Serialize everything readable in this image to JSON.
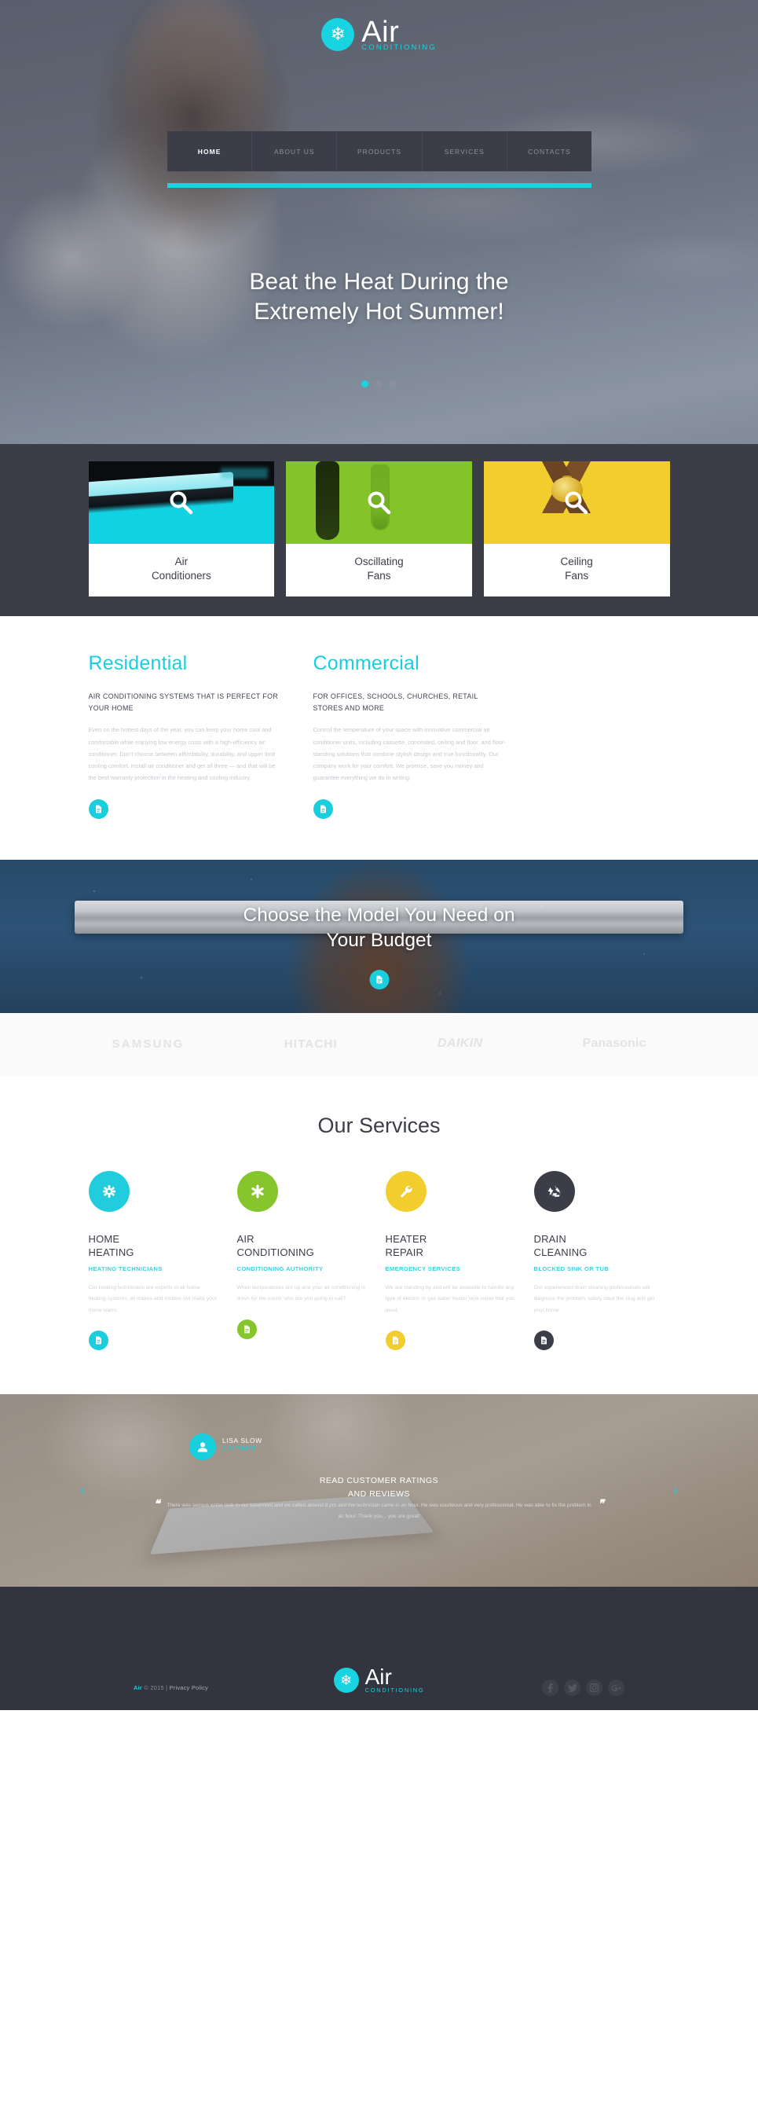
{
  "brand": {
    "name": "Air",
    "tagline": "CONDITIONING",
    "snowflake": "❄",
    "accent": "#17d4e0",
    "dark": "#3b3d49"
  },
  "nav": {
    "items": [
      {
        "label": "HOME",
        "active": true
      },
      {
        "label": "ABOUT US",
        "active": false
      },
      {
        "label": "PRODUCTS",
        "active": false
      },
      {
        "label": "SERVICES",
        "active": false
      },
      {
        "label": "CONTACTS",
        "active": false
      }
    ]
  },
  "hero": {
    "title_line1": "Beat the Heat During the",
    "title_line2": "Extremely Hot Summer!",
    "slides": 3,
    "active_slide": 1
  },
  "products": {
    "cards": [
      {
        "label_line1": "Air",
        "label_line2": "Conditioners",
        "color": "#10d2e2",
        "icon": "search-icon"
      },
      {
        "label_line1": "Oscillating",
        "label_line2": "Fans",
        "color": "#83c429",
        "icon": "search-icon"
      },
      {
        "label_line1": "Ceiling",
        "label_line2": "Fans",
        "color": "#f2cd2e",
        "icon": "search-icon"
      }
    ]
  },
  "rescom": {
    "columns": [
      {
        "heading": "Residential",
        "subheading": "AIR CONDITIONING SYSTEMS THAT IS PERFECT FOR YOUR HOME",
        "body": "Even on the hottest days of the year, you can keep your home cool and comfortable while enjoying low energy costs with a high-efficiency air conditioner. Don't choose between affordability, durability, and upper limit cooling comfort. Install air conditioner and get all three — and that will be the best warranty protection in the heating and cooling industry.",
        "button_color": "#19cfdd"
      },
      {
        "heading": "Commercial",
        "subheading": "FOR OFFICES, SCHOOLS, CHURCHES, RETAIL STORES AND MORE",
        "body": "Control the temperature of your space with innovative commercial air conditioner units, including cassette, concealed, ceiling and floor, and floor-standing solutions that combine stylish design and true functionality. Our company work for your comfort. We promise, save you money and guarantee everything we do in writing.",
        "button_color": "#19cfdd"
      }
    ]
  },
  "banner": {
    "title_line1": "Choose the Model You Need on",
    "title_line2": "Your Budget",
    "button_color": "#19cfdd"
  },
  "brands": {
    "items": [
      {
        "name": "SAMSUNG"
      },
      {
        "name": "HITACHI"
      },
      {
        "name": "DAIKIN"
      },
      {
        "name": "Panasonic"
      }
    ]
  },
  "services": {
    "heading": "Our Services",
    "items": [
      {
        "title_line1": "HOME",
        "title_line2": "HEATING",
        "subtitle": "HEATING TECHNICIANS",
        "description": "Our heating technicians are experts in all home heating systems, all makes and models will make your home warm.",
        "icon": "gear-icon",
        "color": "#21ccdd"
      },
      {
        "title_line1": "AIR",
        "title_line2": "CONDITIONING",
        "subtitle": "CONDITIONING AUTHORITY",
        "description": "When temperatures are up and your air conditioning is down for the count, who are you going to call?",
        "icon": "snowflake-icon",
        "color": "#86c52b"
      },
      {
        "title_line1": "HEATER",
        "title_line2": "REPAIR",
        "subtitle": "EMERGENCY SERVICES",
        "description": "We are standing by and will be available to handle any type of electric or gas water heater tank repair  that you need.",
        "icon": "wrench-icon",
        "color": "#f2cd2e"
      },
      {
        "title_line1": "DRAIN",
        "title_line2": "CLEANING",
        "subtitle": "BLOCKED SINK OR TUB",
        "description": "Our experienced drain cleaning professionals will diagnose the problem, safely clear the clog and get your home.",
        "icon": "recycle-icon",
        "color": "#3b3d49"
      }
    ]
  },
  "testimonial": {
    "author_name": "LISA SLOW",
    "author_role": "CUSTOMER",
    "heading_line1": "READ CUSTOMER RATINGS",
    "heading_line2": "AND REVIEWS",
    "quote": "There was serious water leak in our basement and we called around 8 pm and the technician came in an hour. He was courteous and very professional. He was able to fix the problem in an hour. Thank you... you are great!",
    "prev_arrow": "‹",
    "next_arrow": "›",
    "quote_mark": "❞"
  },
  "footer": {
    "copyright_brand": "Air",
    "copyright_text": "© 2015 |",
    "privacy_label": "Privacy Policy",
    "social": [
      {
        "name": "facebook-icon",
        "glyph": "f"
      },
      {
        "name": "twitter-icon",
        "glyph": "🐦"
      },
      {
        "name": "instagram-icon",
        "glyph": "◙"
      },
      {
        "name": "google-plus-icon",
        "glyph": "g"
      }
    ]
  }
}
